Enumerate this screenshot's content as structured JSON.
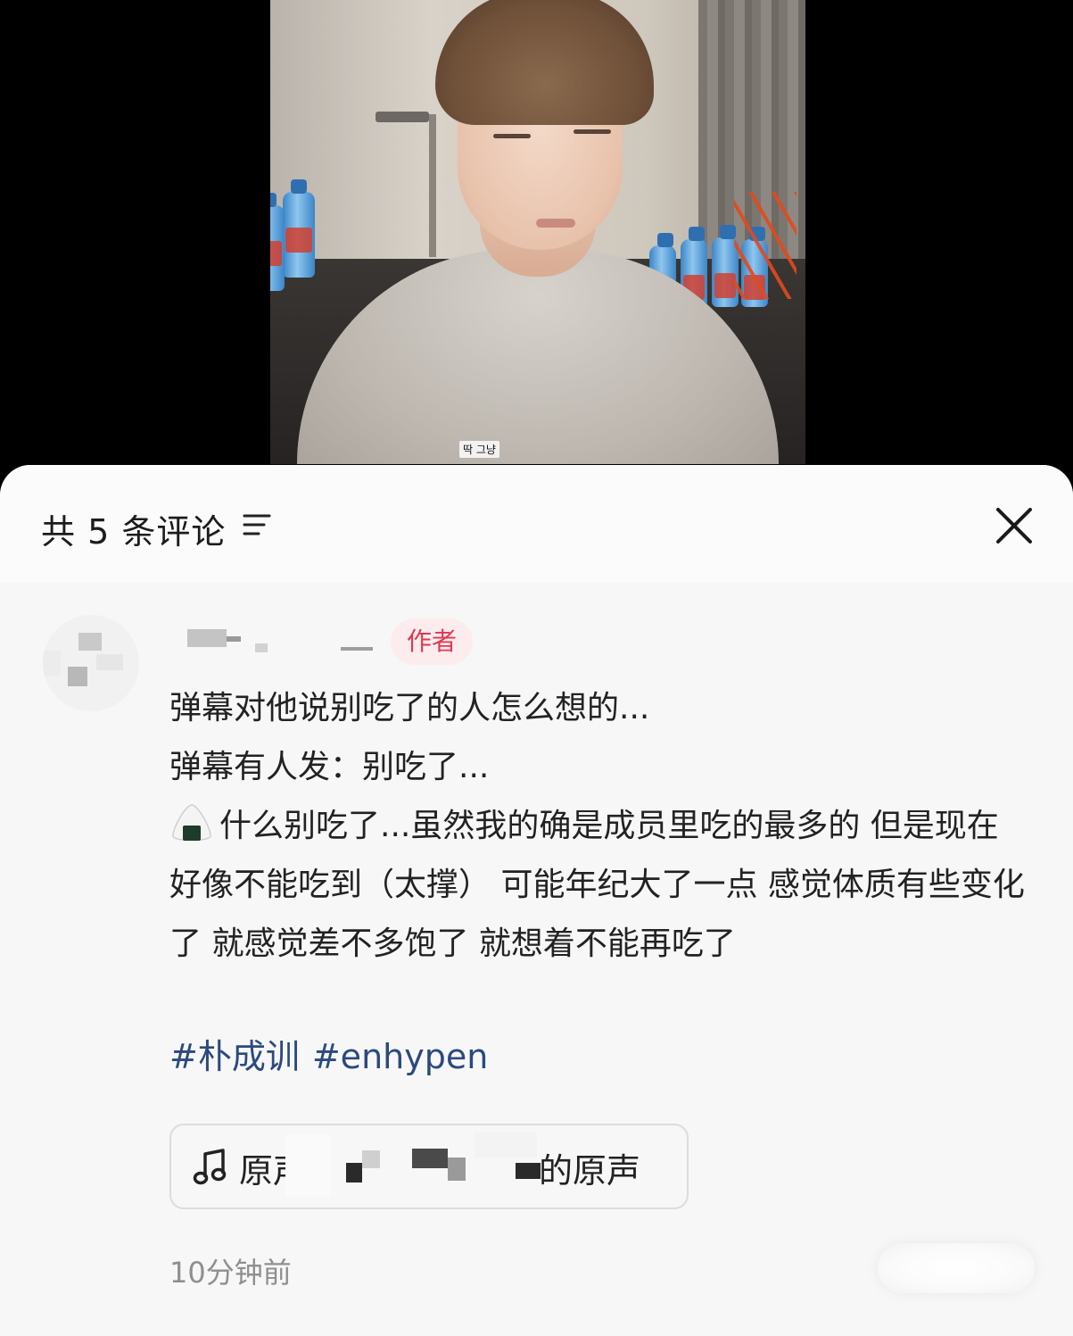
{
  "video": {
    "subtitle": "딱 그냥"
  },
  "comments_panel": {
    "title": "共 5 条评论",
    "filter_icon": "filter-lines-icon",
    "close_icon": "close-x-icon"
  },
  "comment": {
    "author_badge": "作者",
    "lines": [
      "弹幕对他说别吃了的人怎么想的...",
      "弹幕有人发：别吃了..."
    ],
    "paragraph_emoji": "onigiri-icon",
    "paragraph": "什么别吃了...虽然我的确是成员里吃的最多的 但是现在好像不能吃到（太撑） 可能年纪大了一点 感觉体质有些变化了 就感觉差不多饱了 就想着不能再吃了",
    "hashtags": [
      "#朴成训",
      "#enhypen"
    ],
    "sound": {
      "icon": "music-note-icon",
      "prefix": "原声",
      "suffix": "的原声"
    },
    "time": "10分钟前"
  },
  "colors": {
    "sheet_bg": "#f7f7f7",
    "badge_text": "#e2364f",
    "badge_bg": "#fdecee",
    "hashtag": "#2b4a7e",
    "muted": "#8f8f8f"
  }
}
